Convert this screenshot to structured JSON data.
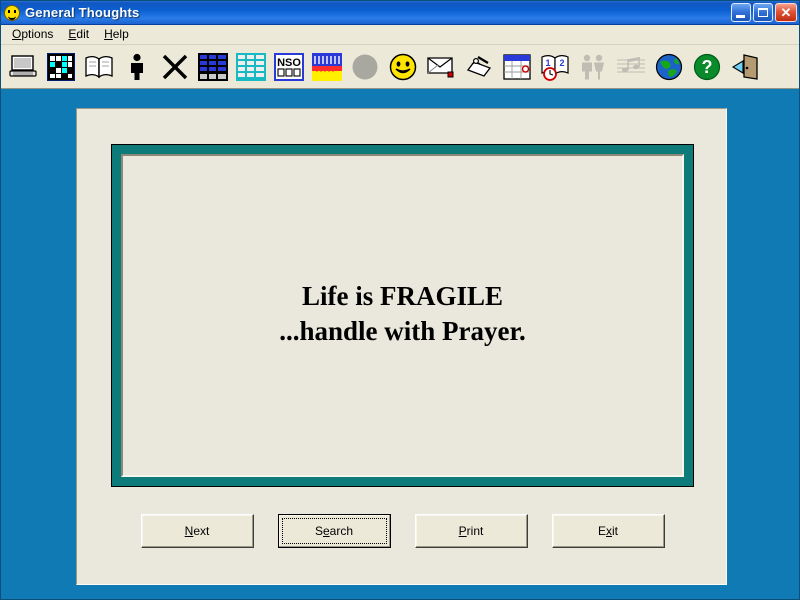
{
  "window": {
    "title": "General Thoughts",
    "icon": "smiley-face-icon",
    "controls": {
      "minimize": "_",
      "maximize": "□",
      "close": "✕"
    }
  },
  "menu": {
    "items": [
      {
        "label": "Options",
        "accel": "O"
      },
      {
        "label": "Edit",
        "accel": "E"
      },
      {
        "label": "Help",
        "accel": "H"
      }
    ]
  },
  "toolbar": {
    "buttons": [
      {
        "name": "computer-icon",
        "label": "Computer",
        "disabled": false
      },
      {
        "name": "crossword-grid-icon",
        "label": "Crossword",
        "disabled": false
      },
      {
        "name": "open-book-icon",
        "label": "Book",
        "disabled": false
      },
      {
        "name": "person-icon",
        "label": "Person",
        "disabled": false
      },
      {
        "name": "close-x-icon",
        "label": "Close",
        "disabled": false
      },
      {
        "name": "blue-table-icon",
        "label": "Blue Table",
        "disabled": false
      },
      {
        "name": "teal-table-icon",
        "label": "Teal Table",
        "disabled": false
      },
      {
        "name": "nso-box-icon",
        "label": "NSO",
        "disabled": false
      },
      {
        "name": "chart-icon",
        "label": "Chart",
        "disabled": false
      },
      {
        "name": "gray-circle-icon",
        "label": "Circle",
        "disabled": false
      },
      {
        "name": "smiley-face-icon",
        "label": "Smiley",
        "disabled": false
      },
      {
        "name": "envelope-icon",
        "label": "Mail",
        "disabled": false
      },
      {
        "name": "hand-writing-icon",
        "label": "Write",
        "disabled": false
      },
      {
        "name": "calendar-icon",
        "label": "Calendar",
        "disabled": false
      },
      {
        "name": "numbers-book-clock-icon",
        "label": "Numbers",
        "disabled": false
      },
      {
        "name": "two-people-icon",
        "label": "People",
        "disabled": true
      },
      {
        "name": "music-notes-icon",
        "label": "Music",
        "disabled": true
      },
      {
        "name": "globe-icon",
        "label": "Globe",
        "disabled": false
      },
      {
        "name": "help-question-icon",
        "label": "Help",
        "disabled": false
      },
      {
        "name": "exit-door-icon",
        "label": "Exit",
        "disabled": false
      }
    ]
  },
  "quote": {
    "text": "Life is FRAGILE\n...handle with Prayer."
  },
  "buttons": [
    {
      "name": "next-button",
      "pre": "",
      "accel": "N",
      "post": "ext",
      "default": false
    },
    {
      "name": "search-button",
      "pre": "S",
      "accel": "e",
      "post": "arch",
      "default": true
    },
    {
      "name": "print-button",
      "pre": "",
      "accel": "P",
      "post": "rint",
      "default": false
    },
    {
      "name": "exit-button",
      "pre": "E",
      "accel": "x",
      "post": "it",
      "default": false
    }
  ],
  "colors": {
    "client_blue": "#0f7ab4",
    "panel_beige": "#eae8dc",
    "frame_teal": "#0e7b7b",
    "face_gray": "#ece9d8",
    "title_blue": "#0b5fd0"
  }
}
